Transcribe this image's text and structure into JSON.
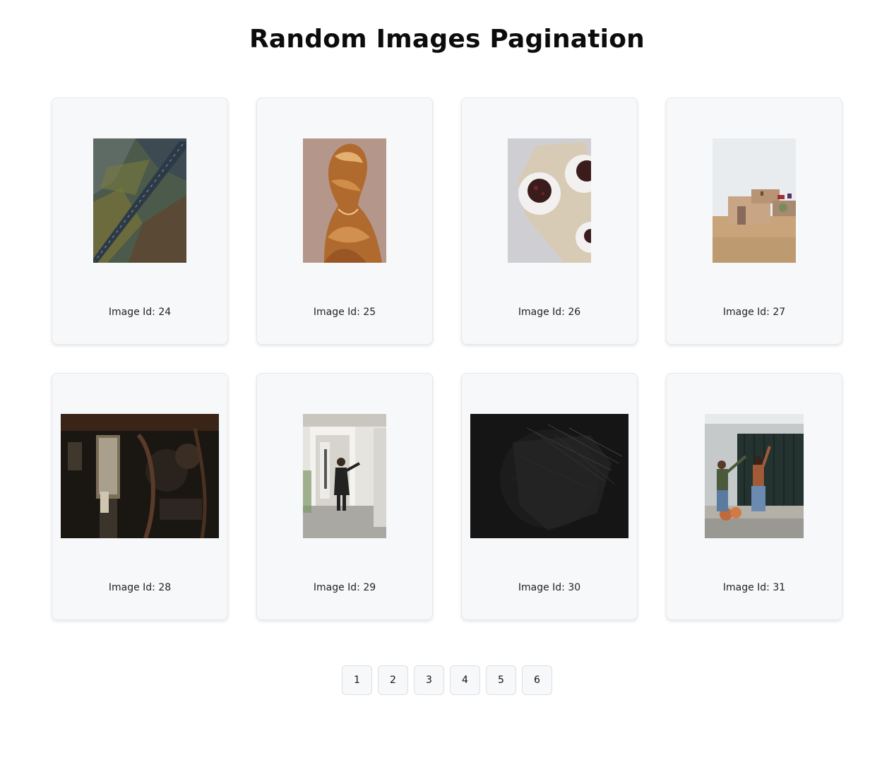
{
  "page": {
    "title": "Random Images Pagination"
  },
  "cards": [
    {
      "caption": "Image Id: 24",
      "photo_desc": "aerial road through mountains"
    },
    {
      "caption": "Image Id: 25",
      "photo_desc": "woman with flowing hair"
    },
    {
      "caption": "Image Id: 26",
      "photo_desc": "chocolate desserts on plates"
    },
    {
      "caption": "Image Id: 27",
      "photo_desc": "desert building"
    },
    {
      "caption": "Image Id: 28",
      "photo_desc": "locomotive cab interior"
    },
    {
      "caption": "Image Id: 29",
      "photo_desc": "man standing in doorway"
    },
    {
      "caption": "Image Id: 30",
      "photo_desc": "dark abstract sphere"
    },
    {
      "caption": "Image Id: 31",
      "photo_desc": "couple hanging curtains"
    }
  ],
  "pagination": {
    "pages": [
      "1",
      "2",
      "3",
      "4",
      "5",
      "6"
    ]
  },
  "colors": {
    "card_bg": "#f7f8fa",
    "card_border": "#e6e8eb",
    "button_border": "#dcdfe3"
  }
}
